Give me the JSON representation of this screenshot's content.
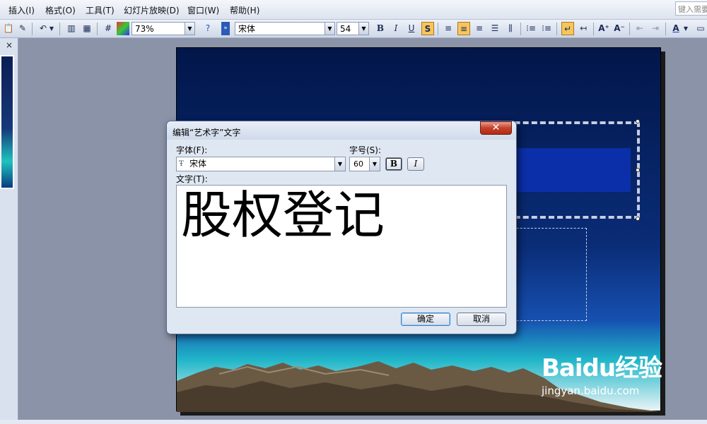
{
  "menu": {
    "insert": "插入(I)",
    "format": "格式(O)",
    "tools": "工具(T)",
    "slideshow": "幻灯片放映(D)",
    "window": "窗口(W)",
    "help": "帮助(H)"
  },
  "help_search": {
    "placeholder": "键入需要"
  },
  "toolbar": {
    "zoom": "73%",
    "font_name": "宋体",
    "font_size": "54",
    "bold": "B",
    "italic": "I",
    "underline": "U",
    "shadow": "S"
  },
  "left_pane": {
    "close": "×"
  },
  "dialog": {
    "title": "编辑“艺术字”文字",
    "font_label": "字体(F):",
    "font_value": "宋体",
    "size_label": "字号(S):",
    "size_value": "60",
    "bold": "B",
    "italic": "I",
    "text_label": "文字(T):",
    "text_value": "股权登记",
    "ok": "确定",
    "cancel": "取消"
  },
  "watermark": {
    "logo": "Baidu经验",
    "url": "jingyan.baidu.com"
  }
}
